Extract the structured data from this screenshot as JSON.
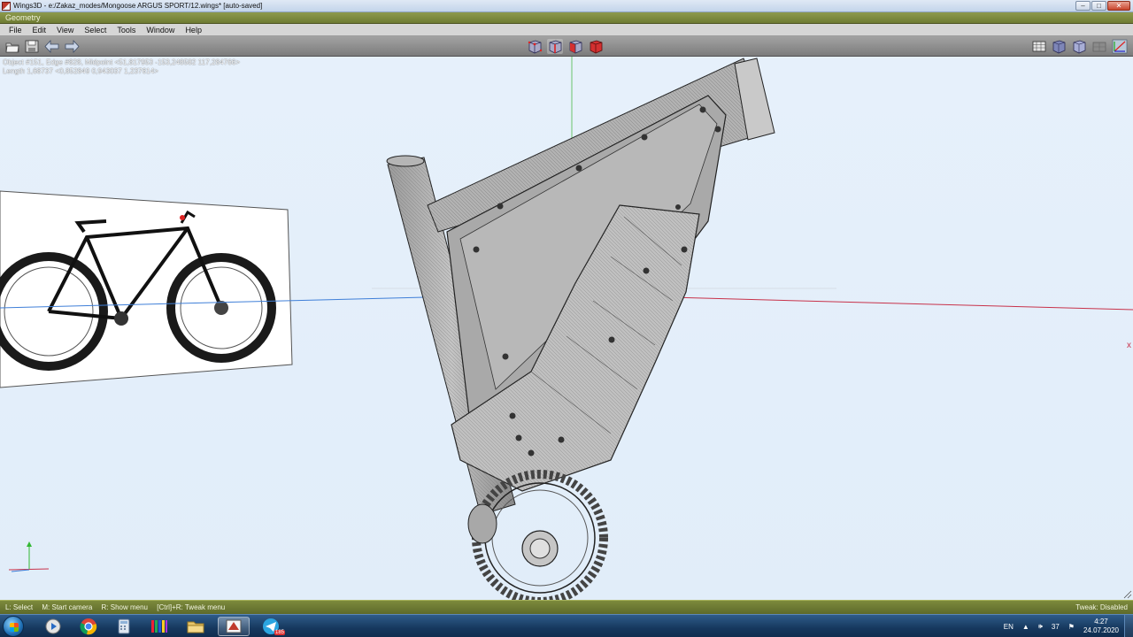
{
  "window": {
    "title": "Wings3D - e:/Zakaz_modes/Mongoose ARGUS SPORT/12.wings* [auto-saved]",
    "minimize_glyph": "–",
    "maximize_glyph": "□",
    "close_glyph": "✕"
  },
  "geometry_label": "Geometry",
  "menu": {
    "items": [
      "File",
      "Edit",
      "View",
      "Select",
      "Tools",
      "Window",
      "Help"
    ]
  },
  "toolbar": {
    "left": [
      "open-file-icon",
      "save-file-icon",
      "undo-arrow-icon",
      "redo-arrow-icon"
    ],
    "selection_modes": [
      "vertex-mode-icon",
      "edge-mode-icon",
      "face-mode-icon",
      "body-mode-icon"
    ],
    "right": [
      "groundplane-icon",
      "smooth-shading-icon",
      "wireframe-icon",
      "axes-toggle-icon",
      "axes-icon"
    ]
  },
  "info": {
    "line1": "Object #151, Edge #828, Midpoint <51,817953  -153,248582  117,284766>",
    "line2": "Length 1,68737  <0,852849  0,943037  1,237614>"
  },
  "viewport": {
    "axis_x_color": "#c8324a",
    "axis_y_color": "#33b833",
    "axis_z_color": "#2b6fd6",
    "x_axis_end_label": "x",
    "reference_image": "fat-bike-reference-photo",
    "model": "ebike-frame-with-battery-and-chainring"
  },
  "status": {
    "hints": [
      "L: Select",
      "M: Start camera",
      "R: Show menu",
      "[Ctrl]+R: Tweak menu"
    ],
    "tweak": "Tweak: Disabled"
  },
  "taskbar": {
    "apps": [
      "windows-explorer-icon",
      "media-player-icon",
      "chrome-icon",
      "calculator-icon",
      "color-picker-icon",
      "folder-icon",
      "wings3d-icon",
      "telegram-icon"
    ],
    "active_app": "wings3d-icon",
    "telegram_badge": "185",
    "lang": "EN",
    "volume": "37",
    "time": "4:27",
    "date": "24.07.2020"
  }
}
